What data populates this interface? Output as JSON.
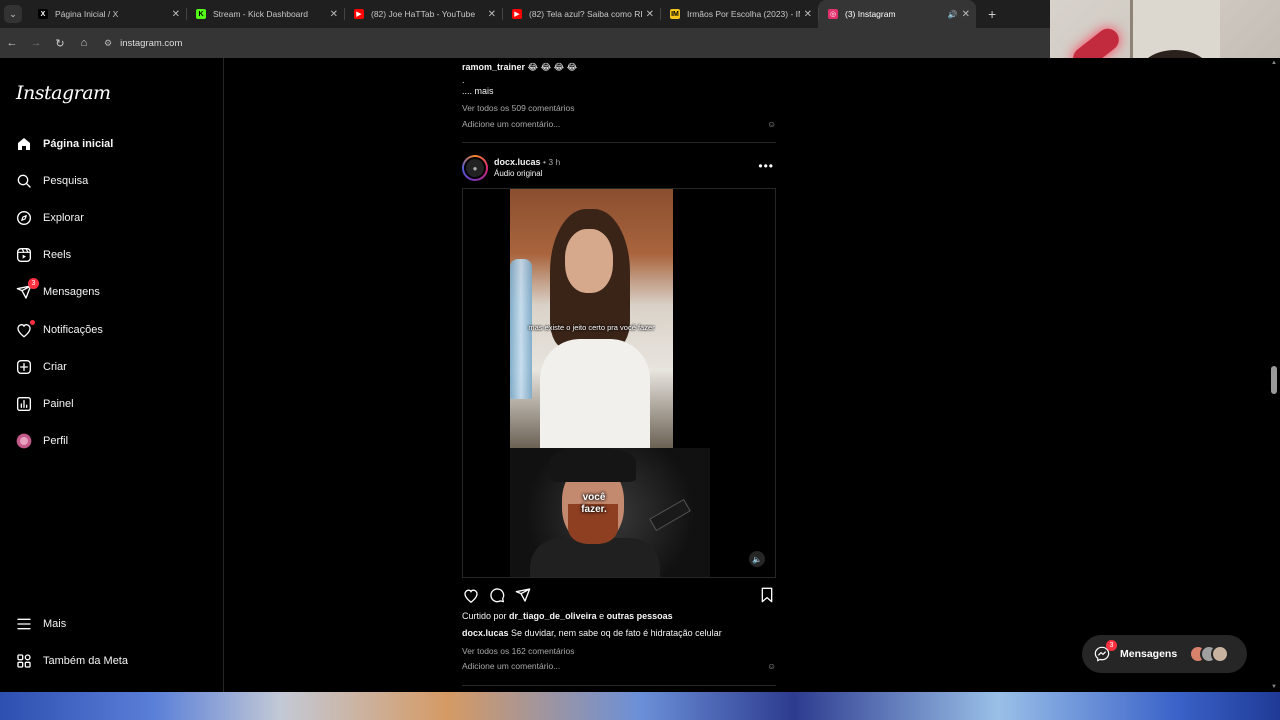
{
  "browser": {
    "tabs": [
      {
        "title": "Página Inicial / X",
        "favicon": "X",
        "color": "#000000",
        "active": false
      },
      {
        "title": "Stream - Kick Dashboard",
        "favicon": "K",
        "color": "#53fc18",
        "active": false
      },
      {
        "title": "(82) Joe HaTTab - YouTube",
        "favicon": "▶",
        "color": "#ff0000",
        "active": false
      },
      {
        "title": "(82) Tela azul? Saiba como RES",
        "favicon": "▶",
        "color": "#ff0000",
        "active": false
      },
      {
        "title": "Irmãos Por Escolha (2023) - IM",
        "favicon": "IM",
        "color": "#f5c518",
        "active": false
      },
      {
        "title": "(3) Instagram",
        "favicon": "◎",
        "color": "#e1306c",
        "active": true
      }
    ],
    "url": "instagram.com"
  },
  "instagram": {
    "logo": "Instagram",
    "nav": [
      {
        "label": "Página inicial",
        "icon": "home-icon",
        "active": true
      },
      {
        "label": "Pesquisa",
        "icon": "search-icon"
      },
      {
        "label": "Explorar",
        "icon": "explore-icon"
      },
      {
        "label": "Reels",
        "icon": "reels-icon"
      },
      {
        "label": "Mensagens",
        "icon": "messages-icon",
        "badge": "3"
      },
      {
        "label": "Notificações",
        "icon": "heart-icon",
        "dot": true
      },
      {
        "label": "Criar",
        "icon": "create-icon"
      },
      {
        "label": "Painel",
        "icon": "dashboard-icon"
      },
      {
        "label": "Perfil",
        "icon": "profile-avatar"
      }
    ],
    "bottom_nav": [
      {
        "label": "Mais",
        "icon": "menu-icon"
      },
      {
        "label": "Também da Meta",
        "icon": "meta-icon"
      }
    ],
    "prev_post": {
      "caption_user": "ramom_trainer",
      "caption_emoji": "😂 😂 😂 😂",
      "caption_dot": ".",
      "more": ".... mais",
      "view_comments": "Ver todos os 509 comentários",
      "add_comment": "Adicione um comentário..."
    },
    "post": {
      "username": "docx.lucas",
      "time": "• 3 h",
      "audio": "Áudio original",
      "subtitle_top": "mas existe o jeito certo pra você fazer",
      "subtitle_bottom": "você fazer.",
      "liked_prefix": "Curtido por",
      "liked_user": "dr_tiago_de_oliveira",
      "liked_and": "e",
      "liked_others": "outras pessoas",
      "caption_user": "docx.lucas",
      "caption_text": "Se duvidar, nem sabe oq de fato é hidratação celular",
      "view_comments": "Ver todos os 162 comentários",
      "add_comment": "Adicione um comentário..."
    },
    "messages_pill": {
      "label": "Mensagens",
      "badge": "3"
    }
  },
  "colors": {
    "accent": "#ff3040",
    "bg": "#000000",
    "divider": "#262626"
  }
}
